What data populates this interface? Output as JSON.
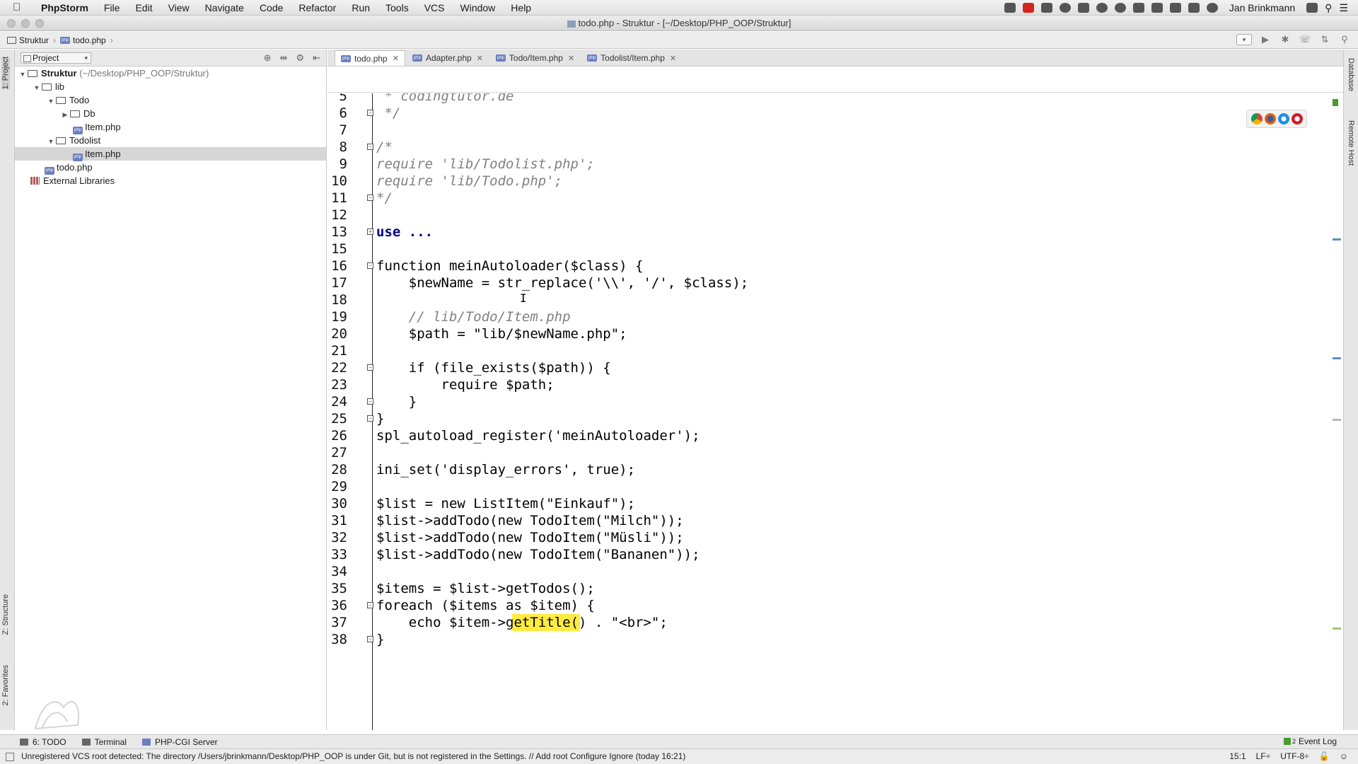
{
  "menubar": {
    "app_name": "PhpStorm",
    "items": [
      "File",
      "Edit",
      "View",
      "Navigate",
      "Code",
      "Refactor",
      "Run",
      "Tools",
      "VCS",
      "Window",
      "Help"
    ],
    "user_name": "Jan Brinkmann"
  },
  "window": {
    "title": "todo.php - Struktur - [~/Desktop/PHP_OOP/Struktur]"
  },
  "breadcrumb": {
    "project": "Struktur",
    "file": "todo.php"
  },
  "project_panel": {
    "view_selector": "Project",
    "tree": [
      {
        "label": "Struktur",
        "suffix": "(~/Desktop/PHP_OOP/Struktur)",
        "type": "folder",
        "level": 0,
        "expanded": true
      },
      {
        "label": "lib",
        "type": "folder",
        "level": 1,
        "expanded": true
      },
      {
        "label": "Todo",
        "type": "folder",
        "level": 2,
        "expanded": true
      },
      {
        "label": "Db",
        "type": "folder",
        "level": 3,
        "expanded": false
      },
      {
        "label": "Item.php",
        "type": "php",
        "level": 3
      },
      {
        "label": "Todolist",
        "type": "folder",
        "level": 2,
        "expanded": true
      },
      {
        "label": "Item.php",
        "type": "php",
        "level": 3,
        "selected": true
      },
      {
        "label": "todo.php",
        "type": "php",
        "level": 1
      },
      {
        "label": "External Libraries",
        "type": "library",
        "level": 0
      }
    ]
  },
  "editor_tabs": [
    {
      "label": "todo.php",
      "active": true
    },
    {
      "label": "Adapter.php",
      "active": false
    },
    {
      "label": "Todo/Item.php",
      "active": false
    },
    {
      "label": "Todolist/Item.php",
      "active": false
    }
  ],
  "code_lines": [
    {
      "n": "5",
      "text": " * codingtutor.de"
    },
    {
      "n": "6",
      "text": " */"
    },
    {
      "n": "7",
      "text": ""
    },
    {
      "n": "8",
      "text": "/*"
    },
    {
      "n": "9",
      "text": "require 'lib/Todolist.php';"
    },
    {
      "n": "10",
      "text": "require 'lib/Todo.php';"
    },
    {
      "n": "11",
      "text": "*/"
    },
    {
      "n": "12",
      "text": ""
    },
    {
      "n": "13",
      "text": "use ..."
    },
    {
      "n": "15",
      "text": ""
    },
    {
      "n": "16",
      "text": "function meinAutoloader($class) {"
    },
    {
      "n": "17",
      "text": "    $newName = str_replace('\\\\', '/', $class);"
    },
    {
      "n": "18",
      "text": ""
    },
    {
      "n": "19",
      "text": "    // lib/Todo/Item.php"
    },
    {
      "n": "20",
      "text": "    $path = \"lib/$newName.php\";"
    },
    {
      "n": "21",
      "text": ""
    },
    {
      "n": "22",
      "text": "    if (file_exists($path)) {"
    },
    {
      "n": "23",
      "text": "        require $path;"
    },
    {
      "n": "24",
      "text": "    }"
    },
    {
      "n": "25",
      "text": "}"
    },
    {
      "n": "26",
      "text": "spl_autoload_register('meinAutoloader');"
    },
    {
      "n": "27",
      "text": ""
    },
    {
      "n": "28",
      "text": "ini_set('display_errors', true);"
    },
    {
      "n": "29",
      "text": ""
    },
    {
      "n": "30",
      "text": "$list = new ListItem(\"Einkauf\");"
    },
    {
      "n": "31",
      "text": "$list->addTodo(new TodoItem(\"Milch\"));"
    },
    {
      "n": "32",
      "text": "$list->addTodo(new TodoItem(\"Müsli\"));"
    },
    {
      "n": "33",
      "text": "$list->addTodo(new TodoItem(\"Bananen\"));"
    },
    {
      "n": "34",
      "text": ""
    },
    {
      "n": "35",
      "text": "$items = $list->getTodos();"
    },
    {
      "n": "36",
      "text": "foreach ($items as $item) {"
    },
    {
      "n": "37",
      "text": "    echo $item->getTitle() . \"<br>\";"
    },
    {
      "n": "38",
      "text": "}"
    }
  ],
  "left_tool_tabs": [
    "1: Project",
    "Z: Structure",
    "2: Favorites"
  ],
  "right_tool_tabs": [
    "Database",
    "Remote Host"
  ],
  "bottom_tool_tabs": [
    "6: TODO",
    "Terminal",
    "PHP-CGI Server"
  ],
  "event_log": "Event Log",
  "event_log_count": "2",
  "status": {
    "message": "Unregistered VCS root detected: The directory /Users/jbrinkmann/Desktop/PHP_OOP is under Git, but is not registered in the Settings. // Add root  Configure  Ignore (today 16:21)",
    "position": "15:1",
    "line_sep": "LF÷",
    "encoding": "UTF-8÷"
  },
  "colors": {
    "highlight": "#ffe400",
    "keyword": "#000080",
    "string": "#008000",
    "comment": "#808080",
    "variable": "#660e7a"
  }
}
